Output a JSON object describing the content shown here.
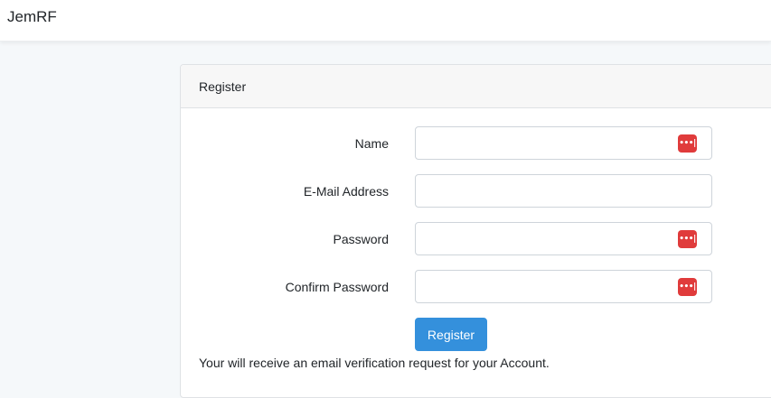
{
  "navbar": {
    "brand": "JemRF"
  },
  "card": {
    "header_title": "Register",
    "fields": [
      {
        "label": "Name",
        "value": "",
        "placeholder": "",
        "has_password_manager_icon": true
      },
      {
        "label": "E-Mail Address",
        "value": "",
        "placeholder": "",
        "has_password_manager_icon": false
      },
      {
        "label": "Password",
        "value": "",
        "placeholder": "",
        "has_password_manager_icon": true
      },
      {
        "label": "Confirm Password",
        "value": "",
        "placeholder": "",
        "has_password_manager_icon": true
      }
    ],
    "submit_label": "Register",
    "notice": "Your will receive an email verification request for your Account."
  },
  "icons": {
    "password_manager": "password-manager-icon",
    "password_manager_glyph": "•••|"
  },
  "colors": {
    "primary": "#3490dc",
    "password_manager_icon_bg": "#e03b3b",
    "page_background": "#f5f8fa"
  }
}
